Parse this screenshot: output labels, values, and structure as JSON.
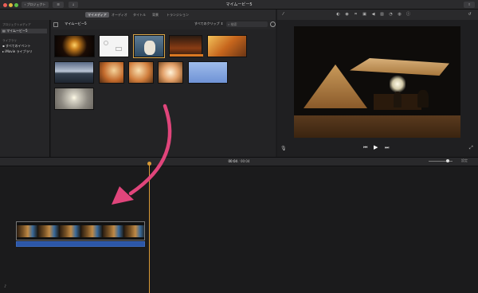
{
  "window": {
    "title": "マイムービー5",
    "back_button": "プロジェクト",
    "traffic_colors": [
      "#ec5f57",
      "#e1b83f",
      "#5dc146"
    ]
  },
  "tabs": [
    {
      "label": "マイメディア",
      "active": true
    },
    {
      "label": "オーディオ",
      "active": false
    },
    {
      "label": "タイトル",
      "active": false
    },
    {
      "label": "背景",
      "active": false
    },
    {
      "label": "トランジション",
      "active": false
    }
  ],
  "sidebar": {
    "section_projects": "プロジェクトメディア",
    "project_item": "マイムービー5",
    "section_library": "ライブラリ",
    "all_events": "すべてのイベント",
    "library_item": "iMovie ライブラリ"
  },
  "browser": {
    "title": "マイムービー5",
    "filter": "すべてのクリップ",
    "search_placeholder": "検索"
  },
  "timeline": {
    "timecode_current": "00:04",
    "timecode_total": "00:04",
    "settings_label": "設定"
  },
  "icons": {
    "toolbar": [
      "wand-icon",
      "color-balance-icon",
      "color-correction-icon",
      "crop-icon",
      "stabilization-icon",
      "volume-icon",
      "noise-reduction-icon",
      "speed-icon",
      "filter-icon",
      "info-icon"
    ],
    "viewer": [
      "microphone-icon",
      "skip-back-icon",
      "play-icon",
      "skip-forward-icon",
      "fullscreen-icon"
    ]
  },
  "accent": "#e0457b"
}
